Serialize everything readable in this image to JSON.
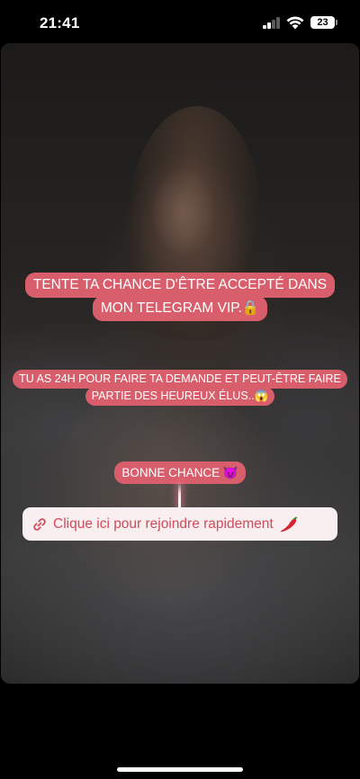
{
  "status_bar": {
    "time": "21:41",
    "battery_level": "23"
  },
  "story": {
    "sticker_1": {
      "lines": [
        "TENTE TA CHANCE D'ÊTRE ACCEPTÉ DANS",
        "MON TELEGRAM VIP."
      ],
      "emoji": "🔒"
    },
    "sticker_2": {
      "lines": [
        "TU AS 24H POUR FAIRE TA DEMANDE ET PEUT-ÊTRE FAIRE",
        "PARTIE DES HEUREUX ÉLUS.."
      ],
      "emoji": "😱"
    },
    "sticker_3": {
      "text": "BONNE CHANCE",
      "emoji": "😈"
    },
    "link": {
      "label": "Clique ici pour rejoindre rapidement",
      "icon": "link-icon",
      "emoji": "chili-pepper"
    }
  },
  "colors": {
    "sticker_bg": "#d95e6b",
    "link_bg": "#f9eef0",
    "link_text": "#d14b5a"
  }
}
